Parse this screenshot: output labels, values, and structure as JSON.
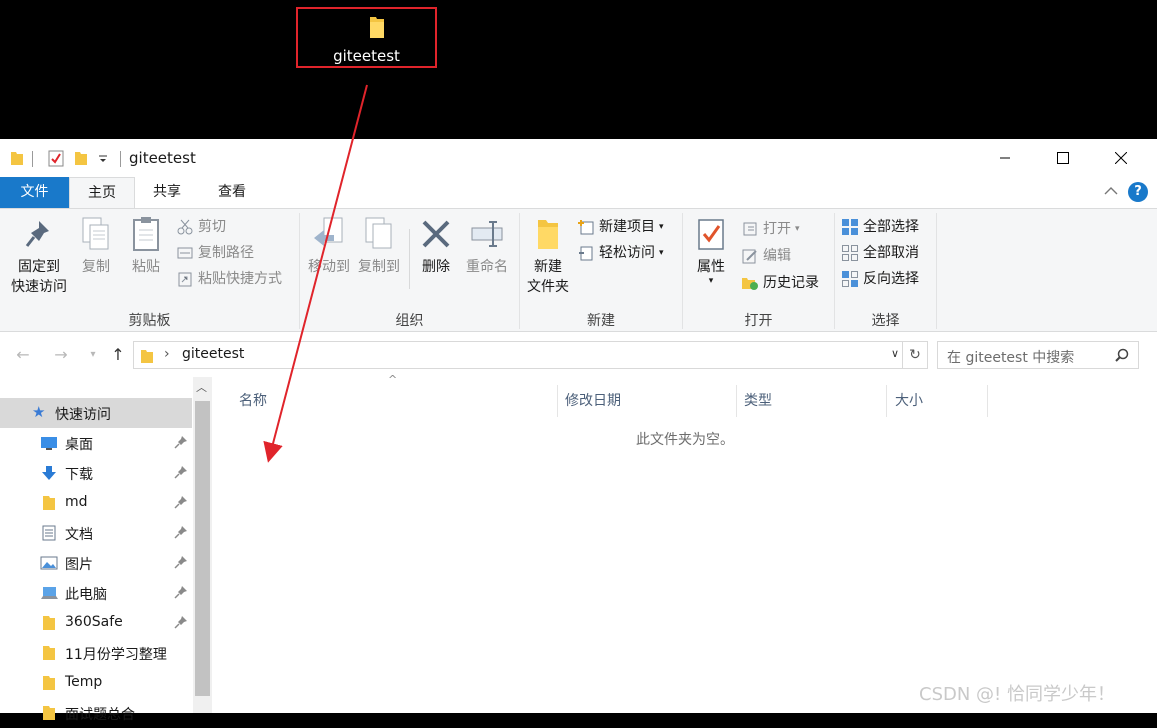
{
  "desktop": {
    "folder_label": "giteetest"
  },
  "window": {
    "title": "giteetest"
  },
  "tabs": [
    {
      "label": "文件"
    },
    {
      "label": "主页"
    },
    {
      "label": "共享"
    },
    {
      "label": "查看"
    }
  ],
  "ribbon": {
    "clipboard": {
      "group_label": "剪贴板",
      "pin_line1": "固定到",
      "pin_line2": "快速访问",
      "copy": "复制",
      "paste": "粘贴",
      "cut": "剪切",
      "copy_path": "复制路径",
      "paste_shortcut": "粘贴快捷方式"
    },
    "organize": {
      "group_label": "组织",
      "move_to": "移动到",
      "copy_to": "复制到",
      "delete": "删除",
      "rename": "重命名"
    },
    "new": {
      "group_label": "新建",
      "new_folder_line1": "新建",
      "new_folder_line2": "文件夹",
      "new_item": "新建项目",
      "easy_access": "轻松访问"
    },
    "open": {
      "group_label": "打开",
      "properties": "属性",
      "open": "打开",
      "edit": "编辑",
      "history": "历史记录"
    },
    "select": {
      "group_label": "选择",
      "select_all": "全部选择",
      "select_none": "全部取消",
      "invert": "反向选择"
    }
  },
  "address": {
    "path": "giteetest",
    "search_placeholder": "在 giteetest 中搜索"
  },
  "nav": {
    "quick_access": "快速访问",
    "items": [
      {
        "label": "桌面",
        "icon": "desktop-icon",
        "pinned": true
      },
      {
        "label": "下载",
        "icon": "download-icon",
        "pinned": true
      },
      {
        "label": "md",
        "icon": "folder-icon",
        "pinned": true
      },
      {
        "label": "文档",
        "icon": "document-icon",
        "pinned": true
      },
      {
        "label": "图片",
        "icon": "picture-icon",
        "pinned": true
      },
      {
        "label": "此电脑",
        "icon": "computer-icon",
        "pinned": true
      },
      {
        "label": "360Safe",
        "icon": "folder-icon",
        "pinned": true
      },
      {
        "label": "11月份学习整理",
        "icon": "folder-icon",
        "pinned": false
      },
      {
        "label": "Temp",
        "icon": "folder-icon",
        "pinned": false
      },
      {
        "label": "面试题总合",
        "icon": "folder-icon",
        "pinned": false
      }
    ]
  },
  "columns": [
    {
      "label": "名称"
    },
    {
      "label": "修改日期"
    },
    {
      "label": "类型"
    },
    {
      "label": "大小"
    }
  ],
  "empty_message": "此文件夹为空。",
  "watermark": "CSDN @! 恰同学少年！",
  "colors": {
    "accent": "#1979ca",
    "highlight_box": "#e0242b",
    "folder": "#f4c542"
  }
}
